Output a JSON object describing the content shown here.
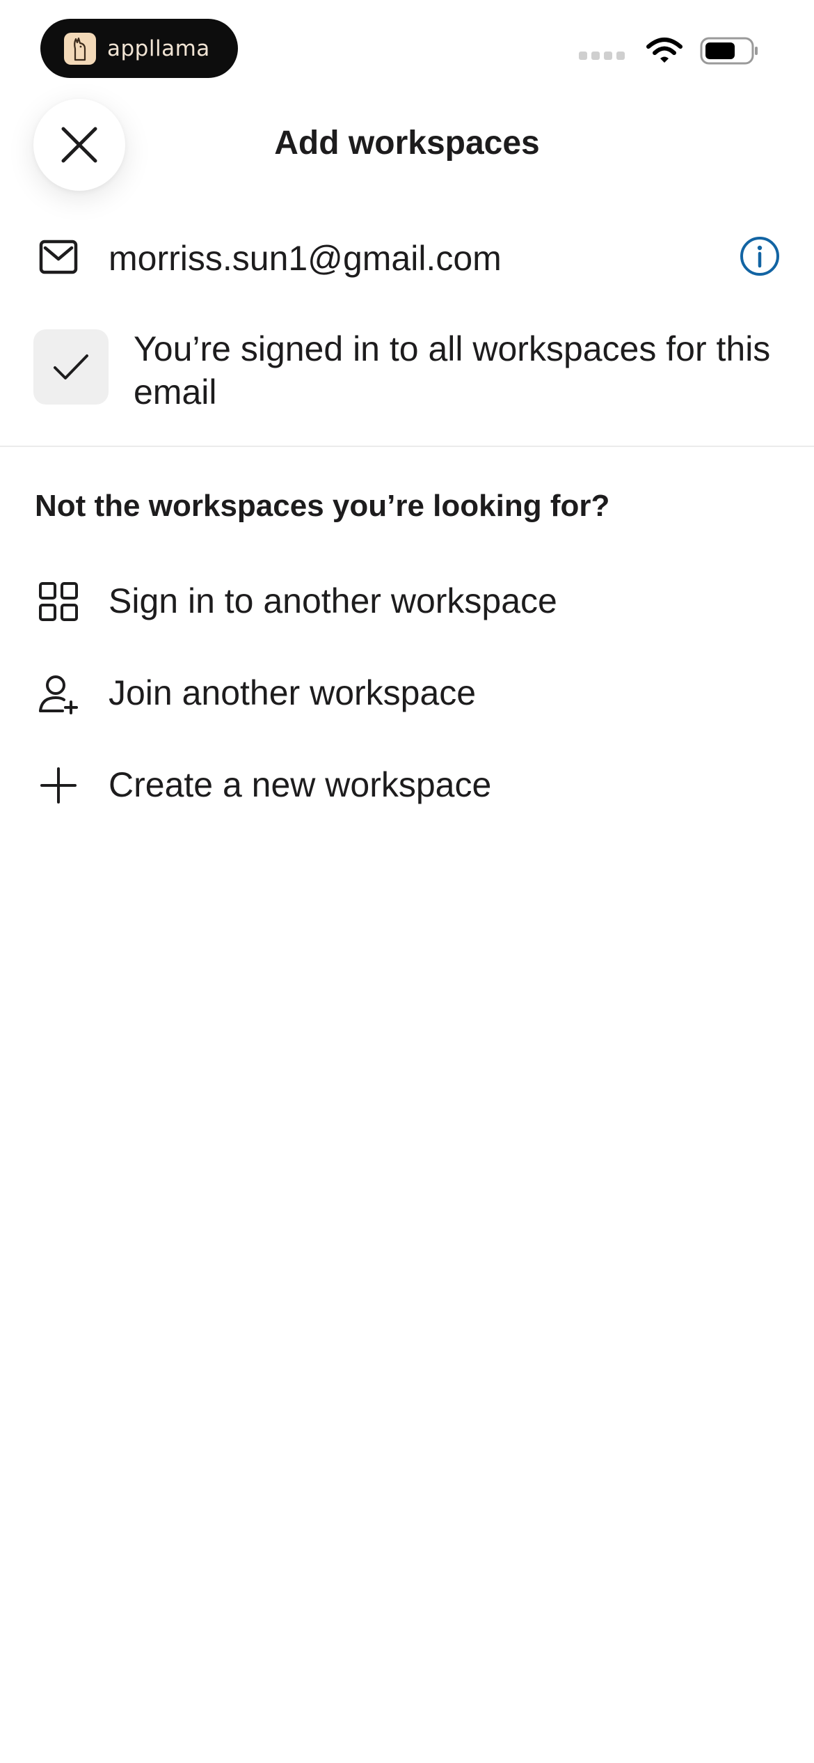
{
  "status_bar": {
    "brand_name": "appllama",
    "icons": [
      "llama-logo-icon",
      "cellular-signal-icon",
      "wifi-icon",
      "battery-icon"
    ]
  },
  "header": {
    "title": "Add workspaces",
    "close_icon": "close-icon"
  },
  "account": {
    "email": "morriss.sun1@gmail.com",
    "icons": [
      "mail-icon",
      "info-icon"
    ],
    "signed_in_message": "You’re signed in to all workspaces for this email",
    "check_icon": "checkmark-icon"
  },
  "options_section": {
    "heading": "Not the workspaces you’re looking for?",
    "items": [
      {
        "label": "Sign in to another workspace",
        "icon": "grid-icon"
      },
      {
        "label": "Join another workspace",
        "icon": "add-person-icon"
      },
      {
        "label": "Create a new workspace",
        "icon": "plus-icon"
      }
    ]
  },
  "colors": {
    "text": "#1d1c1d",
    "info_accent": "#1264a3",
    "check_background": "#efefef",
    "divider": "#ebebeb",
    "brand_pill": "#0d0d0d",
    "brand_text": "#f1e4d4"
  }
}
